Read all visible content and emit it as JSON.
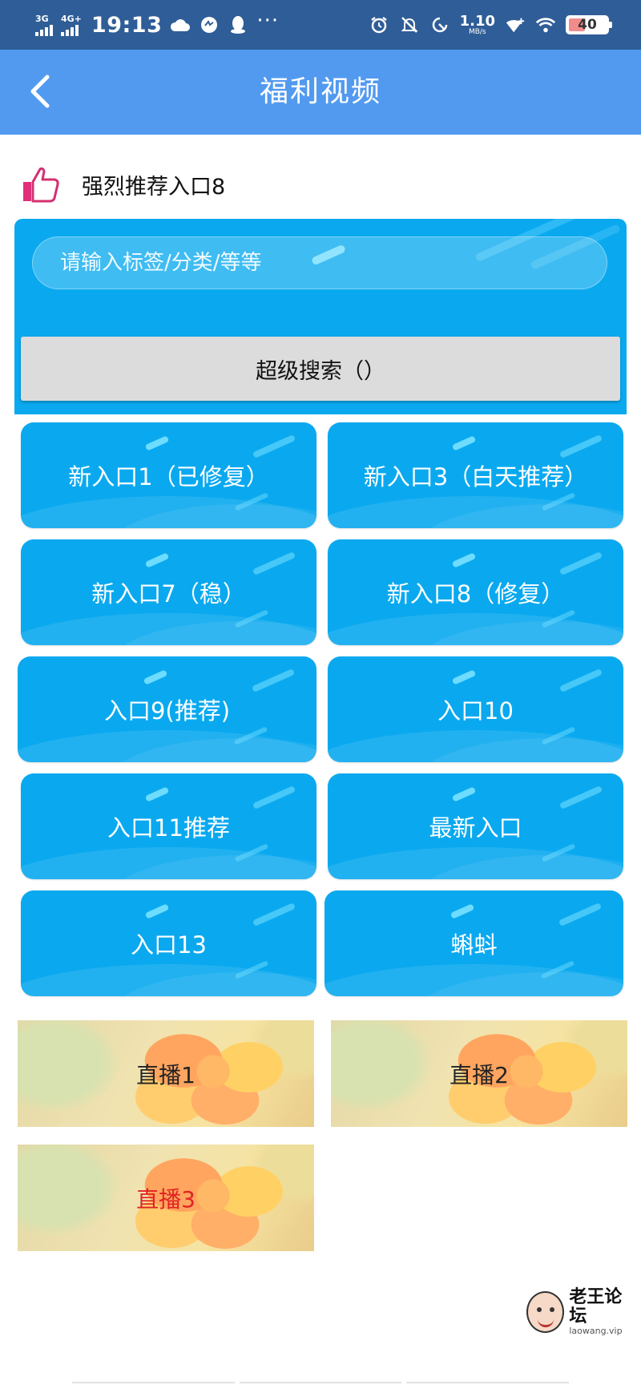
{
  "status_bar": {
    "signal_1": "3G",
    "signal_2": "4G+",
    "time": "19:13",
    "dots": "···",
    "net_speed_value": "1.10",
    "net_speed_unit": "MB/s",
    "battery": "40",
    "battery_level": 0.4
  },
  "nav": {
    "back_icon": "chevron-left-icon",
    "title": "福利视频"
  },
  "recommend": {
    "icon": "thumbs-up-icon",
    "text": "强烈推荐入口8"
  },
  "search": {
    "placeholder": "请输入标签/分类/等等",
    "button_label": "超级搜索（）"
  },
  "entries": [
    {
      "label": "新入口1（已修复）"
    },
    {
      "label": "新入口3（白天推荐）"
    },
    {
      "label": "新入口7（稳）"
    },
    {
      "label": "新入口8（修复）"
    },
    {
      "label": "入口9(推荐)"
    },
    {
      "label": "入口10"
    },
    {
      "label": "入口11推荐"
    },
    {
      "label": "最新入口"
    },
    {
      "label": "入口13"
    },
    {
      "label": "蝌蚪"
    }
  ],
  "live": [
    {
      "label": "直播1",
      "color": "#111111"
    },
    {
      "label": "直播2",
      "color": "#111111"
    },
    {
      "label": "直播3",
      "color": "#e01010"
    }
  ],
  "watermark": {
    "name": "老王论坛",
    "url": "laowang.vip"
  },
  "colors": {
    "status_bar": "#2f5d97",
    "nav_bar": "#529af0",
    "tile_blue": "#0aa9ef",
    "thumb_icon": "#e0307a"
  }
}
